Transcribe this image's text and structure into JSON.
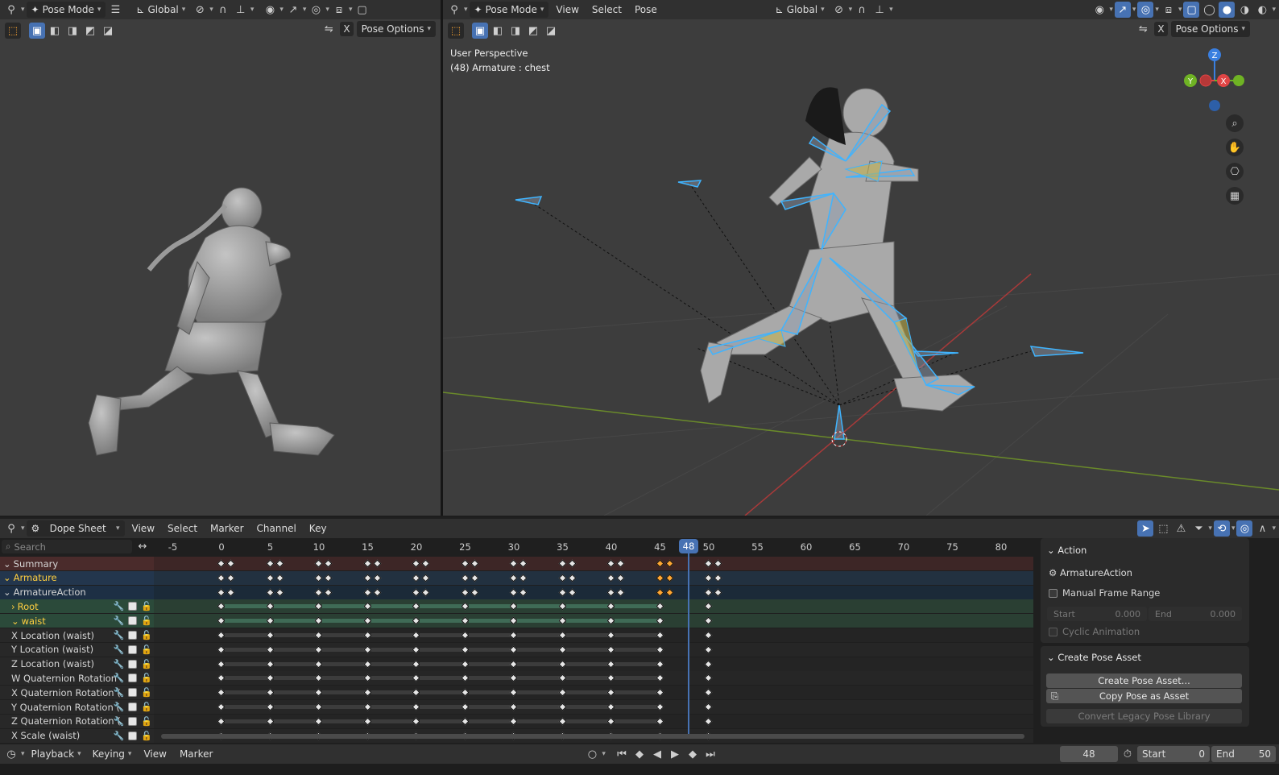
{
  "left_viewport": {
    "header": {
      "mode": "Pose Mode",
      "orientation": "Global"
    },
    "pose_options": "Pose Options",
    "x_label": "X"
  },
  "right_viewport": {
    "header": {
      "mode": "Pose Mode",
      "menus": [
        "View",
        "Select",
        "Pose"
      ],
      "orientation": "Global"
    },
    "pose_options": "Pose Options",
    "x_label": "X",
    "overlay_title": "User Perspective",
    "overlay_subtitle": "(48) Armature : chest",
    "gizmo": {
      "z": "Z",
      "y": "Y",
      "x": "X"
    }
  },
  "dopesheet": {
    "editor": "Dope Sheet",
    "menus": [
      "View",
      "Select",
      "Marker",
      "Channel",
      "Key"
    ],
    "search_placeholder": "Search",
    "ruler": [
      "-5",
      "0",
      "5",
      "10",
      "15",
      "20",
      "25",
      "30",
      "35",
      "40",
      "45",
      "50",
      "55",
      "60",
      "65",
      "70",
      "75",
      "80"
    ],
    "current_frame": "48",
    "channels": [
      {
        "label": "Summary"
      },
      {
        "label": "Armature"
      },
      {
        "label": "ArmatureAction"
      },
      {
        "label": "Root"
      },
      {
        "label": "waist"
      },
      {
        "label": "X Location (waist)"
      },
      {
        "label": "Y Location (waist)"
      },
      {
        "label": "Z Location (waist)"
      },
      {
        "label": "W Quaternion Rotation"
      },
      {
        "label": "X Quaternion Rotation ("
      },
      {
        "label": "Y Quaternion Rotation ("
      },
      {
        "label": "Z Quaternion Rotation ("
      },
      {
        "label": "X Scale (waist)"
      }
    ],
    "keyframes": [
      0,
      5,
      10,
      15,
      20,
      25,
      30,
      35,
      40,
      45,
      50
    ],
    "selected_keyframe": 45
  },
  "sidebar": {
    "action_title": "Action",
    "action_name": "ArmatureAction",
    "manual_frame_range": "Manual Frame Range",
    "start_label": "Start",
    "start_value": "0.000",
    "end_label": "End",
    "end_value": "0.000",
    "cyclic": "Cyclic Animation",
    "create_pose_title": "Create Pose Asset",
    "create_pose_btn": "Create Pose Asset...",
    "copy_pose_btn": "Copy Pose as Asset",
    "convert_btn": "Convert Legacy Pose Library"
  },
  "timeline": {
    "menus": [
      "Playback",
      "Keying",
      "View",
      "Marker"
    ],
    "frame": "48",
    "start_label": "Start",
    "start": "0",
    "end_label": "End",
    "end": "50"
  }
}
